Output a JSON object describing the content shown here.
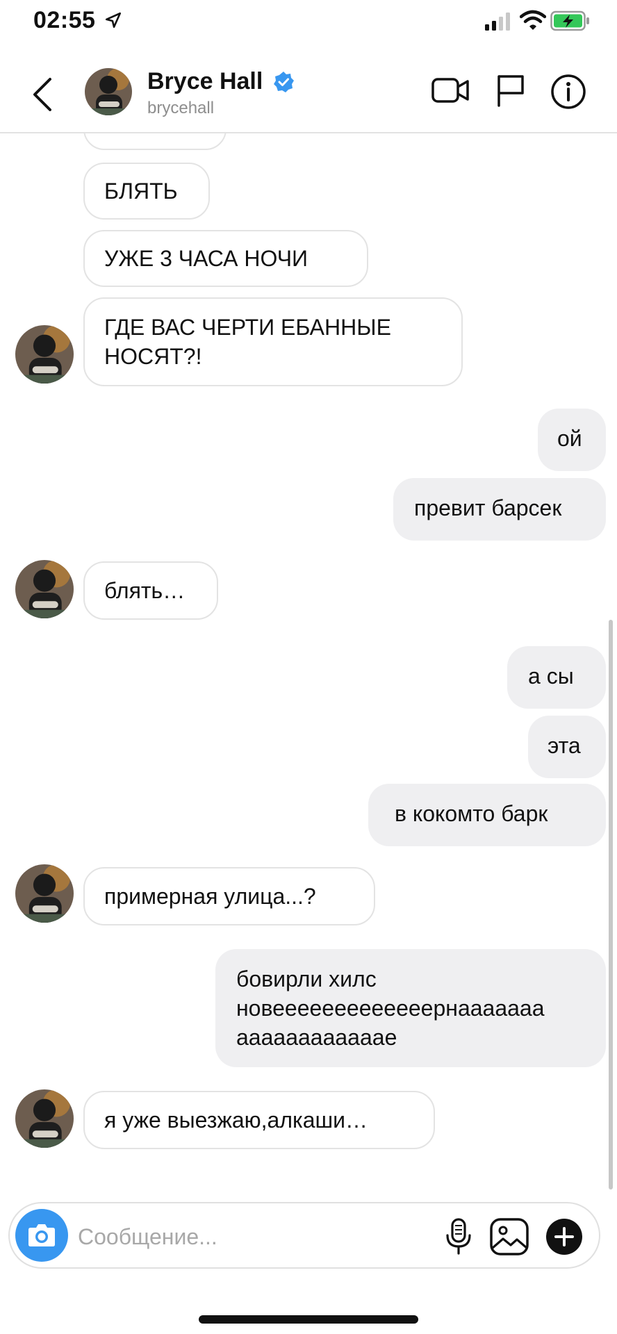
{
  "status_bar": {
    "time": "02:55"
  },
  "header": {
    "name": "Bryce Hall",
    "username": "brycehall",
    "avatar": "profile-photo"
  },
  "messages": [
    {
      "side": "in",
      "text": ""
    },
    {
      "side": "in",
      "text": "БЛЯТЬ"
    },
    {
      "side": "in",
      "text": "УЖЕ 3 ЧАСА НОЧИ"
    },
    {
      "side": "in",
      "lines": [
        "ГДЕ ВАС ЧЕРТИ ЕБАННЫЕ",
        "НОСЯТ?!"
      ]
    },
    {
      "side": "out",
      "text": "ой"
    },
    {
      "side": "out",
      "text": "превит барсек"
    },
    {
      "side": "in",
      "text": "блять…"
    },
    {
      "side": "out",
      "text": "а сы"
    },
    {
      "side": "out",
      "text": "эта"
    },
    {
      "side": "out",
      "text": "в кокомто барк"
    },
    {
      "side": "in",
      "text": "примерная улица...?"
    },
    {
      "side": "out",
      "lines": [
        "бовирли хилс",
        "новееееееееееееернааааааа",
        "аааааааааааае"
      ]
    },
    {
      "side": "in",
      "text": "я уже выезжаю,алкаши…"
    }
  ],
  "composer": {
    "placeholder": "Сообщение...",
    "icons": [
      "camera-icon",
      "microphone-icon",
      "gallery-icon",
      "plus-icon"
    ]
  },
  "colors": {
    "accent": "#3897f0",
    "outgoing_bubble": "#efeff1",
    "incoming_border": "#e3e3e3",
    "verified": "#3897f0",
    "battery": "#34c759"
  }
}
